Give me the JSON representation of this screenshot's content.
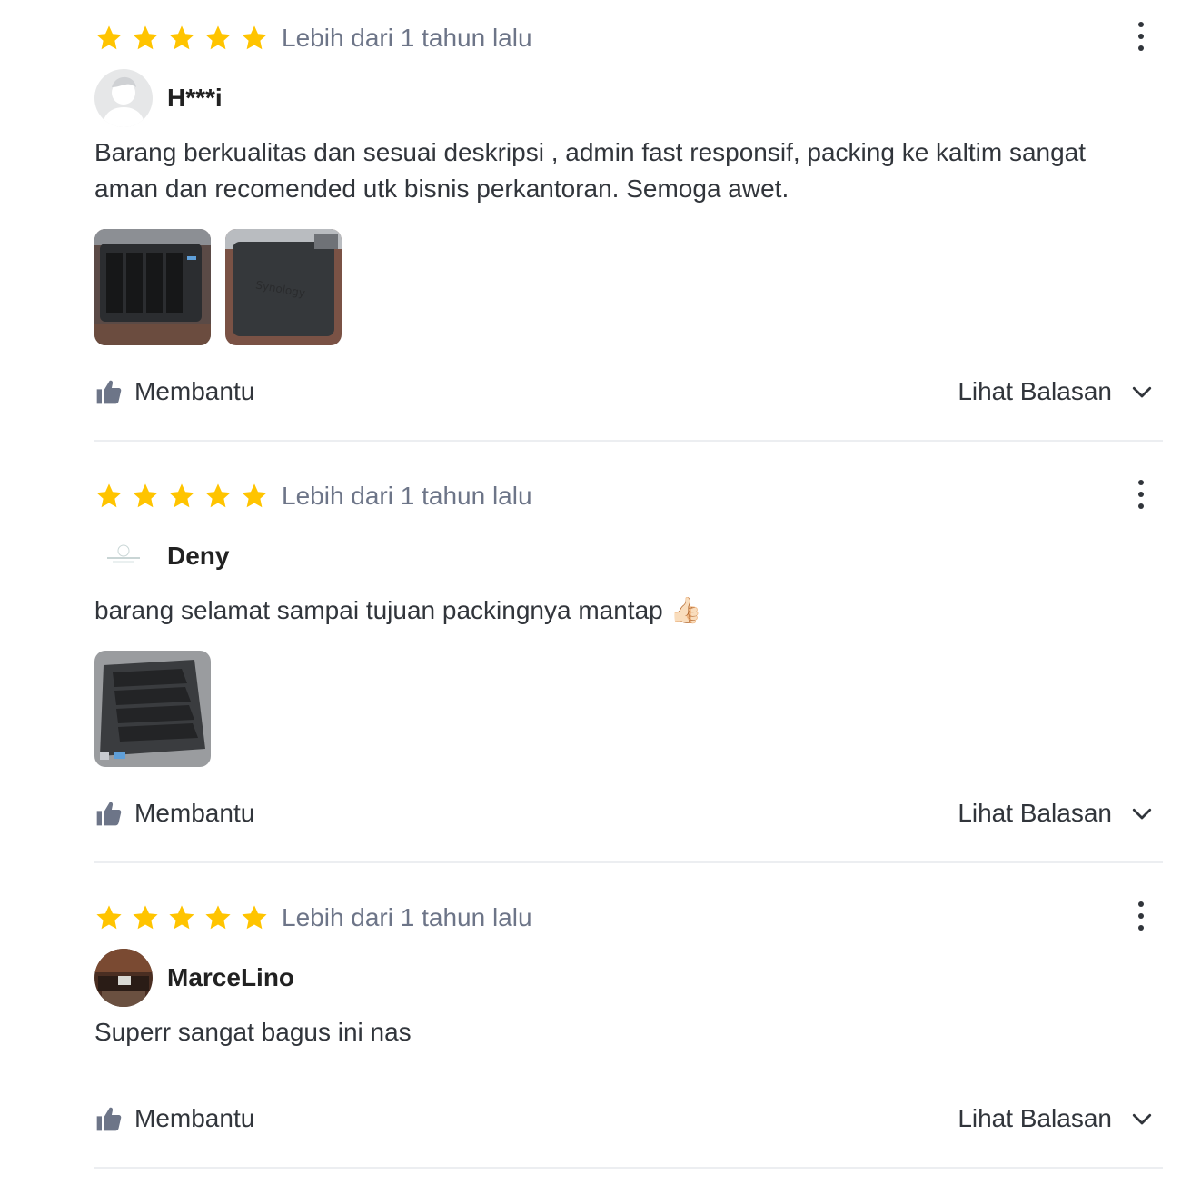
{
  "colors": {
    "star": "#ffc400",
    "text": "#31353b",
    "muted": "#6d7588",
    "divider": "#eceef1",
    "thumbs": "#6d7588"
  },
  "icons": {
    "rating": "star-icon",
    "more": "kebab-menu-icon",
    "helpful": "thumbs-up-icon",
    "expand": "chevron-down-icon"
  },
  "reviews": [
    {
      "rating": 5,
      "time": "Lebih dari 1 tahun lalu",
      "user": "H***i",
      "text": "Barang berkualitas dan sesuai deskripsi , admin fast responsif, packing ke kaltim sangat aman dan recomended utk bisnis perkantoran. Semoga awet.",
      "image_count": 2,
      "image_brand": "Synology",
      "helpful_label": "Membantu",
      "replies_label": "Lihat Balasan"
    },
    {
      "rating": 5,
      "time": "Lebih dari 1 tahun lalu",
      "user": "Deny",
      "text": "barang selamat sampai tujuan packingnya mantap 👍🏻",
      "image_count": 1,
      "helpful_label": "Membantu",
      "replies_label": "Lihat Balasan"
    },
    {
      "rating": 5,
      "time": "Lebih dari 1 tahun lalu",
      "user": "MarceLino",
      "text": "Superr sangat bagus ini nas",
      "image_count": 0,
      "helpful_label": "Membantu",
      "replies_label": "Lihat Balasan"
    }
  ]
}
